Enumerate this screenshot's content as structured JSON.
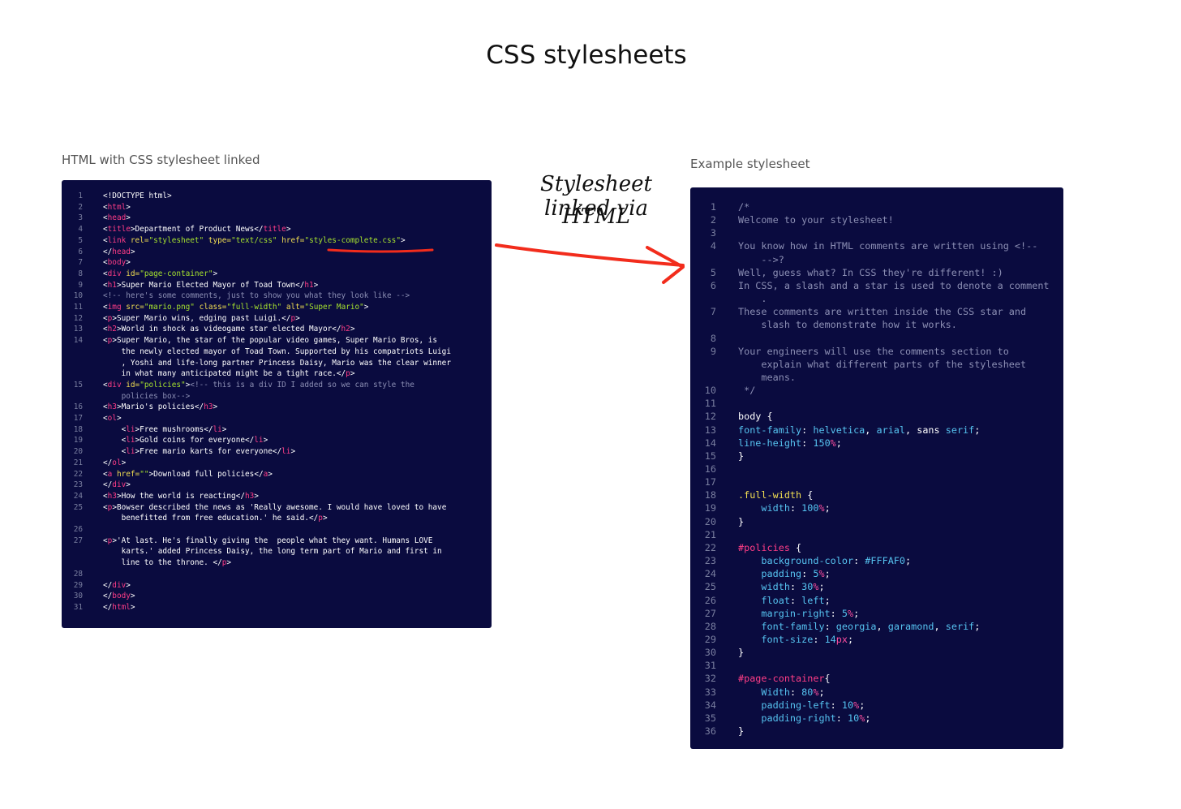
{
  "page": {
    "title": "CSS stylesheets"
  },
  "left_panel": {
    "label": "HTML with CSS stylesheet linked",
    "lines": [
      {
        "n": "1",
        "html": "&lt;!DOCTYPE html&gt;"
      },
      {
        "n": "2",
        "html": "&lt;<span class='tg'>html</span>&gt;"
      },
      {
        "n": "3",
        "html": "&lt;<span class='tg'>head</span>&gt;"
      },
      {
        "n": "4",
        "html": "&lt;<span class='tg'>title</span>&gt;Department of Product News&lt;/<span class='tg'>title</span>&gt;"
      },
      {
        "n": "5",
        "html": "&lt;<span class='tg'>link</span> <span class='at'>rel=</span><span class='st'>\"stylesheet\"</span> <span class='at'>type=</span><span class='st'>\"text/css\"</span> <span class='at'>href=</span><span class='st'>\"styles-complete.css\"</span>&gt;"
      },
      {
        "n": "6",
        "html": "&lt;/<span class='tg'>head</span>&gt;"
      },
      {
        "n": "7",
        "html": "&lt;<span class='tg'>body</span>&gt;"
      },
      {
        "n": "8",
        "html": "&lt;<span class='tg'>div</span> <span class='at'>id=</span><span class='st'>\"page-container\"</span>&gt;"
      },
      {
        "n": "9",
        "html": "&lt;<span class='tg'>h1</span>&gt;Super Mario Elected Mayor of Toad Town&lt;/<span class='tg'>h1</span>&gt;"
      },
      {
        "n": "10",
        "html": "<span class='cm'>&lt;!-- here's some comments, just to show you what they look like --&gt;</span>"
      },
      {
        "n": "11",
        "html": "&lt;<span class='tg'>img</span> <span class='at'>src=</span><span class='st'>\"mario.png\"</span> <span class='at'>class=</span><span class='st'>\"full-width\"</span> <span class='at'>alt=</span><span class='st'>\"Super Mario\"</span>&gt;"
      },
      {
        "n": "12",
        "html": "&lt;<span class='tg'>p</span>&gt;Super Mario wins, edging past Luigi.&lt;/<span class='tg'>p</span>&gt;"
      },
      {
        "n": "13",
        "html": "&lt;<span class='tg'>h2</span>&gt;World in shock as videogame star elected Mayor&lt;/<span class='tg'>h2</span>&gt;"
      },
      {
        "n": "14",
        "html": "&lt;<span class='tg'>p</span>&gt;Super Mario, the star of the popular video games, Super Mario Bros, is"
      },
      {
        "n": "",
        "html": "    the newly elected mayor of Toad Town. Supported by his compatriots Luigi"
      },
      {
        "n": "",
        "html": "    , Yoshi and life-long partner Princess Daisy, Mario was the clear winner"
      },
      {
        "n": "",
        "html": "    in what many anticipated might be a tight race.&lt;/<span class='tg'>p</span>&gt;"
      },
      {
        "n": "15",
        "html": "&lt;<span class='tg'>div</span> <span class='at'>id=</span><span class='st'>\"policies\"</span>&gt;<span class='cm'>&lt;!-- this is a div ID I added so we can style the</span>"
      },
      {
        "n": "",
        "html": "<span class='cm'>    policies box--&gt;</span>"
      },
      {
        "n": "16",
        "html": "&lt;<span class='tg'>h3</span>&gt;Mario's policies&lt;/<span class='tg'>h3</span>&gt;"
      },
      {
        "n": "17",
        "html": "&lt;<span class='tg'>ol</span>&gt;"
      },
      {
        "n": "18",
        "html": "    &lt;<span class='tg'>li</span>&gt;Free mushrooms&lt;/<span class='tg'>li</span>&gt;"
      },
      {
        "n": "19",
        "html": "    &lt;<span class='tg'>li</span>&gt;Gold coins for everyone&lt;/<span class='tg'>li</span>&gt;"
      },
      {
        "n": "20",
        "html": "    &lt;<span class='tg'>li</span>&gt;Free mario karts for everyone&lt;/<span class='tg'>li</span>&gt;"
      },
      {
        "n": "21",
        "html": "&lt;/<span class='tg'>ol</span>&gt;"
      },
      {
        "n": "22",
        "html": "&lt;<span class='tg'>a</span> <span class='at'>href=</span><span class='st'>\"\"</span>&gt;Download full policies&lt;/<span class='tg'>a</span>&gt;"
      },
      {
        "n": "23",
        "html": "&lt;/<span class='tg'>div</span>&gt;"
      },
      {
        "n": "24",
        "html": "&lt;<span class='tg'>h3</span>&gt;How the world is reacting&lt;/<span class='tg'>h3</span>&gt;"
      },
      {
        "n": "25",
        "html": "&lt;<span class='tg'>p</span>&gt;Bowser described the news as 'Really awesome. I would have loved to have"
      },
      {
        "n": "",
        "html": "    benefitted from free education.' he said.&lt;/<span class='tg'>p</span>&gt;"
      },
      {
        "n": "26",
        "html": ""
      },
      {
        "n": "27",
        "html": "&lt;<span class='tg'>p</span>&gt;'At last. He's finally giving the  people what they want. Humans LOVE"
      },
      {
        "n": "",
        "html": "    karts.' added Princess Daisy, the long term part of Mario and first in"
      },
      {
        "n": "",
        "html": "    line to the throne. &lt;/<span class='tg'>p</span>&gt;"
      },
      {
        "n": "28",
        "html": ""
      },
      {
        "n": "29",
        "html": "&lt;/<span class='tg'>div</span>&gt;"
      },
      {
        "n": "30",
        "html": "&lt;/<span class='tg'>body</span>&gt;"
      },
      {
        "n": "31",
        "html": "&lt;/<span class='tg'>html</span>&gt;"
      }
    ]
  },
  "annotation": {
    "line1": "Stylesheet linked via",
    "line2": "HTML",
    "color": "#f22c1c"
  },
  "right_panel": {
    "label": "Example stylesheet",
    "lines": [
      {
        "n": "1",
        "html": "<span class='cm'>/*</span>"
      },
      {
        "n": "2",
        "html": "<span class='cm'>Welcome to your stylesheet!</span>"
      },
      {
        "n": "3",
        "html": ""
      },
      {
        "n": "4",
        "html": "<span class='cm'>You know how in HTML comments are written using &lt;!--</span>"
      },
      {
        "n": "",
        "html": "<span class='cm'>    --&gt;?</span>"
      },
      {
        "n": "5",
        "html": "<span class='cm'>Well, guess what? In CSS they're different! :)</span>"
      },
      {
        "n": "6",
        "html": "<span class='cm'>In CSS, a slash and a star is used to denote a comment</span>"
      },
      {
        "n": "",
        "html": "<span class='cm'>    .</span>"
      },
      {
        "n": "7",
        "html": "<span class='cm'>These comments are written inside the CSS star and</span>"
      },
      {
        "n": "",
        "html": "<span class='cm'>    slash to demonstrate how it works.</span>"
      },
      {
        "n": "8",
        "html": ""
      },
      {
        "n": "9",
        "html": "<span class='cm'>Your engineers will use the comments section to</span>"
      },
      {
        "n": "",
        "html": "<span class='cm'>    explain what different parts of the stylesheet</span>"
      },
      {
        "n": "",
        "html": "<span class='cm'>    means.</span>"
      },
      {
        "n": "10",
        "html": "<span class='cm'> */</span>"
      },
      {
        "n": "11",
        "html": ""
      },
      {
        "n": "12",
        "html": "body {"
      },
      {
        "n": "13",
        "html": "<span class='pr'>font-family</span>: <span class='pr'>helvetica</span>, <span class='pr'>arial</span>, sans <span class='pr'>serif</span>;"
      },
      {
        "n": "14",
        "html": "<span class='pr'>line-height</span>: <span class='pr'>150</span><span class='un'>%</span>;"
      },
      {
        "n": "15",
        "html": "}"
      },
      {
        "n": "16",
        "html": ""
      },
      {
        "n": "17",
        "html": ""
      },
      {
        "n": "18",
        "html": "<span class='sel-cl'>.full-width</span> {"
      },
      {
        "n": "19",
        "html": "    <span class='pr'>width</span>: <span class='pr'>100</span><span class='un'>%</span>;"
      },
      {
        "n": "20",
        "html": "}"
      },
      {
        "n": "21",
        "html": ""
      },
      {
        "n": "22",
        "html": "<span class='sel-id'>#policies</span> {"
      },
      {
        "n": "23",
        "html": "    <span class='pr'>background-color</span>: <span class='pr'>#FFFAF0</span>;"
      },
      {
        "n": "24",
        "html": "    <span class='pr'>padding</span>: <span class='pr'>5</span><span class='un'>%</span>;"
      },
      {
        "n": "25",
        "html": "    <span class='pr'>width</span>: <span class='pr'>30</span><span class='un'>%</span>;"
      },
      {
        "n": "26",
        "html": "    <span class='pr'>float</span>: <span class='pr'>left</span>;"
      },
      {
        "n": "27",
        "html": "    <span class='pr'>margin-right</span>: <span class='pr'>5</span><span class='un'>%</span>;"
      },
      {
        "n": "28",
        "html": "    <span class='pr'>font-family</span>: <span class='pr'>georgia</span>, <span class='pr'>garamond</span>, <span class='pr'>serif</span>;"
      },
      {
        "n": "29",
        "html": "    <span class='pr'>font-size</span>: <span class='pr'>14</span><span class='un'>px</span>;"
      },
      {
        "n": "30",
        "html": "}"
      },
      {
        "n": "31",
        "html": ""
      },
      {
        "n": "32",
        "html": "<span class='sel-id'>#page-container</span>{"
      },
      {
        "n": "33",
        "html": "    <span class='pr'>Width</span>: <span class='pr'>80</span><span class='un'>%</span>;"
      },
      {
        "n": "34",
        "html": "    <span class='pr'>padding-left</span>: <span class='pr'>10</span><span class='un'>%</span>;"
      },
      {
        "n": "35",
        "html": "    <span class='pr'>padding-right</span>: <span class='pr'>10</span><span class='un'>%</span>;"
      },
      {
        "n": "36",
        "html": "}"
      }
    ]
  }
}
